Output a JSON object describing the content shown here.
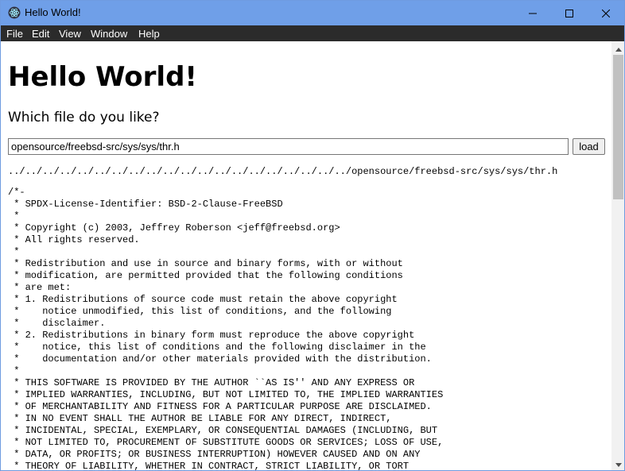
{
  "window": {
    "title": "Hello World!"
  },
  "menu": [
    "File",
    "Edit",
    "View",
    "Window",
    "Help"
  ],
  "page": {
    "heading": "Hello World!",
    "question": "Which file do you like?",
    "input_value": "opensource/freebsd-src/sys/sys/thr.h",
    "load_label": "load",
    "resolved_path": "../../../../../../../../../../../../../../../../../../../../opensource/freebsd-src/sys/sys/thr.h",
    "file_content": "/*-\n * SPDX-License-Identifier: BSD-2-Clause-FreeBSD\n *\n * Copyright (c) 2003, Jeffrey Roberson <jeff@freebsd.org>\n * All rights reserved.\n *\n * Redistribution and use in source and binary forms, with or without\n * modification, are permitted provided that the following conditions\n * are met:\n * 1. Redistributions of source code must retain the above copyright\n *    notice unmodified, this list of conditions, and the following\n *    disclaimer.\n * 2. Redistributions in binary form must reproduce the above copyright\n *    notice, this list of conditions and the following disclaimer in the\n *    documentation and/or other materials provided with the distribution.\n *\n * THIS SOFTWARE IS PROVIDED BY THE AUTHOR ``AS IS'' AND ANY EXPRESS OR\n * IMPLIED WARRANTIES, INCLUDING, BUT NOT LIMITED TO, THE IMPLIED WARRANTIES\n * OF MERCHANTABILITY AND FITNESS FOR A PARTICULAR PURPOSE ARE DISCLAIMED.\n * IN NO EVENT SHALL THE AUTHOR BE LIABLE FOR ANY DIRECT, INDIRECT,\n * INCIDENTAL, SPECIAL, EXEMPLARY, OR CONSEQUENTIAL DAMAGES (INCLUDING, BUT\n * NOT LIMITED TO, PROCUREMENT OF SUBSTITUTE GOODS OR SERVICES; LOSS OF USE,\n * DATA, OR PROFITS; OR BUSINESS INTERRUPTION) HOWEVER CAUSED AND ON ANY\n * THEORY OF LIABILITY, WHETHER IN CONTRACT, STRICT LIABILITY, OR TORT"
  },
  "icons": {
    "app": "electron-atom-icon",
    "minimize": "minimize-icon",
    "maximize": "maximize-icon",
    "close": "close-icon",
    "scroll_up": "scroll-up-arrow-icon",
    "scroll_down": "scroll-down-arrow-icon"
  },
  "colors": {
    "titlebar": "#6f9fe8",
    "menubar": "#2b2b2b",
    "scrollbar_track": "#f1f1f1",
    "scrollbar_thumb": "#c1c1c1"
  },
  "scroll": {
    "thumb_position_fraction": 0,
    "visible_fraction": 0.36
  }
}
